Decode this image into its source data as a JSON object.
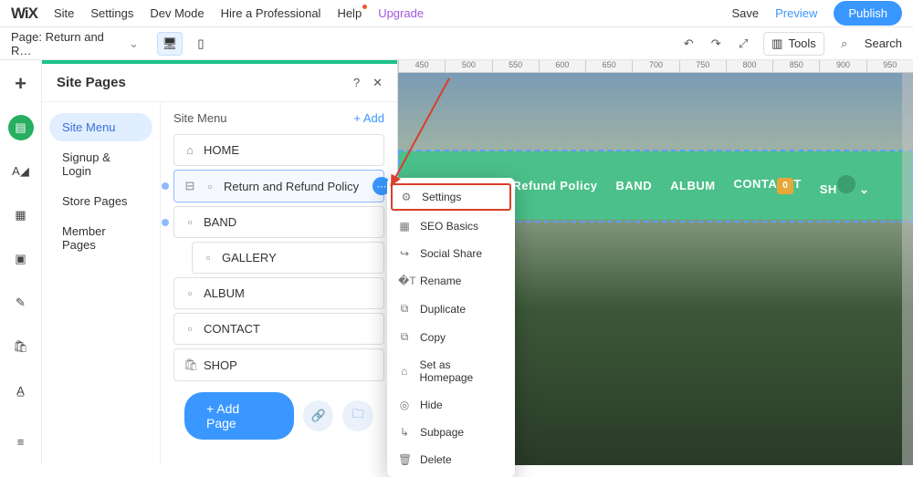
{
  "logo": "WiX",
  "top_menu": [
    "Site",
    "Settings",
    "Dev Mode",
    "Hire a Professional",
    "Help",
    "Upgrade"
  ],
  "top_right": {
    "save": "Save",
    "preview": "Preview",
    "publish": "Publish"
  },
  "page_selector": "Page: Return and R…",
  "tools_label": "Tools",
  "search_label": "Search",
  "panel": {
    "title": "Site Pages",
    "sidebar": [
      "Site Menu",
      "Signup & Login",
      "Store Pages",
      "Member Pages"
    ],
    "main_title": "Site Menu",
    "add_label": "+ Add",
    "pages": [
      {
        "icon": "home",
        "label": "HOME",
        "indent": 0
      },
      {
        "icon": "page",
        "label": "Return and Refund Policy",
        "indent": 0,
        "selected": true,
        "expanded": true
      },
      {
        "icon": "page",
        "label": "BAND",
        "indent": 0,
        "expanded": true
      },
      {
        "icon": "page",
        "label": "GALLERY",
        "indent": 1
      },
      {
        "icon": "page",
        "label": "ALBUM",
        "indent": 0
      },
      {
        "icon": "page",
        "label": "CONTACT",
        "indent": 0
      },
      {
        "icon": "shop",
        "label": "SHOP",
        "indent": 0
      }
    ],
    "add_page": "+ Add Page"
  },
  "context_menu": [
    "Settings",
    "SEO Basics",
    "Social Share",
    "Rename",
    "Duplicate",
    "Copy",
    "Set as Homepage",
    "Hide",
    "Subpage",
    "Delete"
  ],
  "context_icons": [
    "⚙",
    "▦",
    "↪",
    "�T",
    "⧉",
    "⧉",
    "⌂",
    "◎",
    "↳",
    "🗑"
  ],
  "site_nav": [
    "Return and Refund Policy",
    "BAND",
    "ALBUM",
    "CONTA",
    "SH"
  ],
  "cart_count": "0",
  "ruler": [
    "450",
    "500",
    "550",
    "600",
    "650",
    "700",
    "750",
    "800",
    "850",
    "900",
    "950"
  ]
}
